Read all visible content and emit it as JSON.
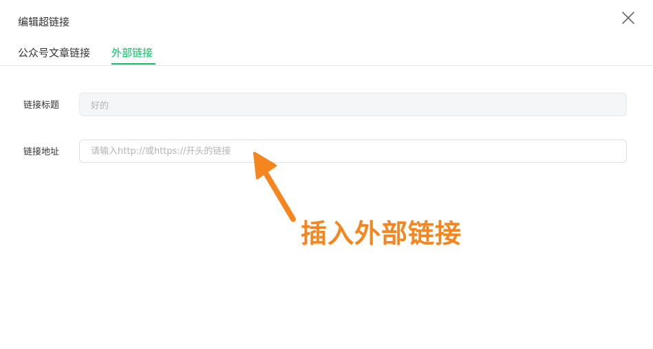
{
  "dialog": {
    "title": "编辑超链接",
    "close_icon": "close-icon"
  },
  "tabs": [
    {
      "label": "公众号文章链接",
      "active": false
    },
    {
      "label": "外部链接",
      "active": true
    }
  ],
  "form": {
    "title_label": "链接标题",
    "title_value": "好的",
    "url_label": "链接地址",
    "url_placeholder": "请输入http://或https://开头的链接"
  },
  "annotation": {
    "text": "插入外部链接",
    "color": "#f5861f"
  },
  "colors": {
    "accent": "#07c160",
    "annotation": "#f5861f"
  }
}
